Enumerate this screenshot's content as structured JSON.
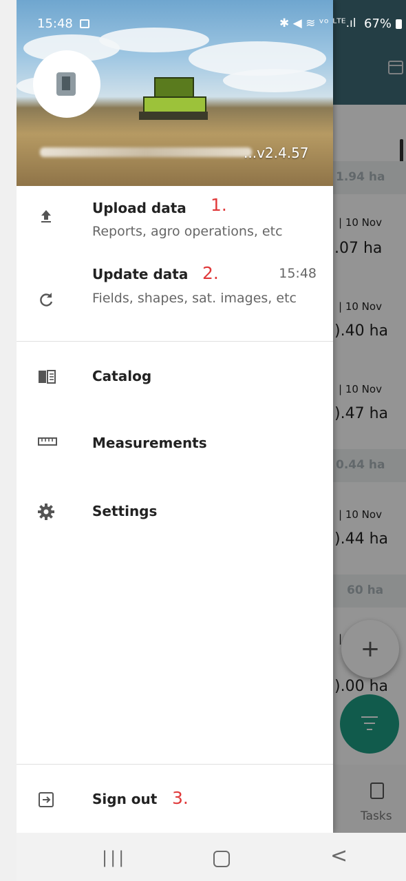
{
  "status_bar": {
    "time": "15:48",
    "battery": "67%",
    "icons_text": "✱ ◀ ≋ ᵛᵒ ᴸᵀᴱ.ıl"
  },
  "drawer": {
    "version": "...v2.4.57",
    "menu": [
      {
        "icon": "upload-icon",
        "title": "Upload data",
        "subtitle": "Reports, agro operations, etc",
        "annotation": "1."
      },
      {
        "icon": "refresh-icon",
        "title": "Update data",
        "subtitle": "Fields, shapes, sat. images, etc",
        "time": "15:48",
        "annotation": "2."
      },
      {
        "icon": "book-icon",
        "title": "Catalog"
      },
      {
        "icon": "ruler-icon",
        "title": "Measurements"
      },
      {
        "icon": "gear-icon",
        "title": "Settings"
      }
    ],
    "sign_out": {
      "icon": "sign-out-icon",
      "title": "Sign out",
      "annotation": "3."
    }
  },
  "background": {
    "groups": [
      "1.94 ha",
      "0.44 ha",
      "60 ha"
    ],
    "rows": [
      {
        "date": "| 10 Nov",
        "area": ".07 ha"
      },
      {
        "date": "| 10 Nov",
        "area": ").40 ha"
      },
      {
        "date": "| 10 Nov",
        "area": ").47 ha"
      },
      {
        "date": "| 10 Nov",
        "area": ").44 ha"
      },
      {
        "date": "|",
        "area": ").00 ha"
      }
    ],
    "fab_add": "+",
    "bottom_tab": "Tasks"
  },
  "colors": {
    "accent": "#1e9e84",
    "toolbar": "#3f6b78",
    "annotation": "#e0393a"
  }
}
